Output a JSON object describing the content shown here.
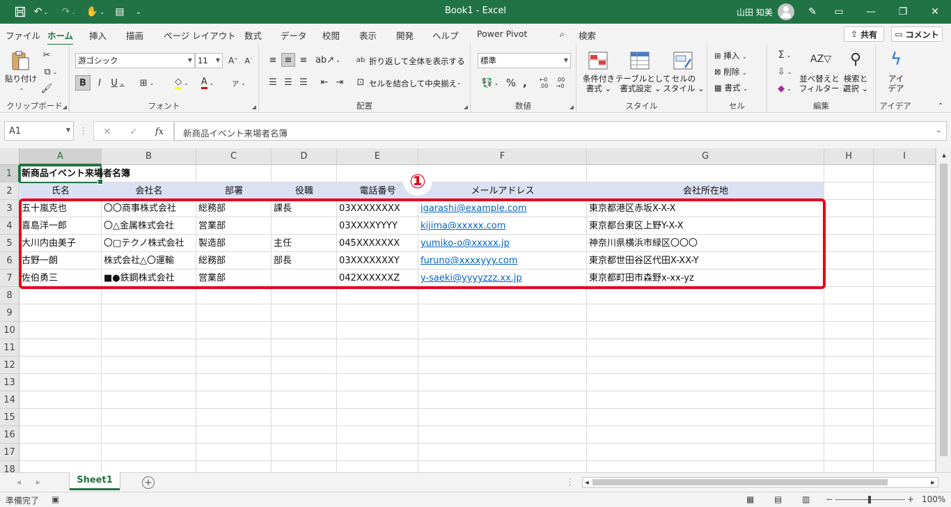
{
  "window": {
    "title": "Book1  -  Excel",
    "user": "山田 知美"
  },
  "menu": {
    "tabs": [
      "ファイル",
      "ホーム",
      "挿入",
      "描画",
      "ページ レイアウト",
      "数式",
      "データ",
      "校閲",
      "表示",
      "開発",
      "ヘルプ",
      "Power Pivot"
    ],
    "search": "検索",
    "share": "共有",
    "comment": "コメント"
  },
  "ribbon": {
    "clipboard": {
      "label": "クリップボード",
      "paste": "貼り付け"
    },
    "font": {
      "label": "フォント",
      "name": "游ゴシック",
      "size": "11"
    },
    "alignment": {
      "label": "配置",
      "wrap": "折り返して全体を表示する",
      "merge": "セルを結合して中央揃え"
    },
    "number": {
      "label": "数値",
      "format": "標準"
    },
    "styles": {
      "label": "スタイル",
      "conditional": [
        "条件付き",
        "書式"
      ],
      "table": [
        "テーブルとして",
        "書式設定"
      ],
      "cell": [
        "セルの",
        "スタイル"
      ]
    },
    "cells": {
      "label": "セル",
      "insert": "挿入",
      "delete": "削除",
      "format": "書式"
    },
    "editing": {
      "label": "編集",
      "sort": [
        "並べ替えと",
        "フィルター"
      ],
      "find": [
        "検索と",
        "選択"
      ]
    },
    "ideas": {
      "label": "アイデア",
      "button": [
        "アイ",
        "デア"
      ]
    }
  },
  "formula_bar": {
    "name_box": "A1",
    "formula": "新商品イベント来場者名簿"
  },
  "sheet": {
    "columns": [
      "A",
      "B",
      "C",
      "D",
      "E",
      "F",
      "G",
      "H",
      "I"
    ],
    "rows": [
      "1",
      "2",
      "3",
      "4",
      "5",
      "6",
      "7",
      "8",
      "9",
      "10",
      "11",
      "12",
      "13",
      "14",
      "15",
      "16",
      "17",
      "18"
    ],
    "title": "新商品イベント来場者名簿",
    "headers": [
      "氏名",
      "会社名",
      "部署",
      "役職",
      "電話番号",
      "メールアドレス",
      "会社所在地"
    ],
    "records": [
      [
        "五十嵐克也",
        "〇〇商事株式会社",
        "総務部",
        "課長",
        "03XXXXXXXX",
        "igarashi@example.com",
        "東京都港区赤坂X-X-X"
      ],
      [
        "喜島洋一郎",
        "〇△金属株式会社",
        "営業部",
        "",
        "03XXXXYYYY",
        "kijima@xxxxx.com",
        "東京都台東区上野Y-X-X"
      ],
      [
        "大川内由美子",
        "〇□テクノ株式会社",
        "製造部",
        "主任",
        "045XXXXXXX",
        "yumiko-o@xxxxx.jp",
        "神奈川県横浜市緑区〇〇〇"
      ],
      [
        "古野一朗",
        "株式会社△〇運輸",
        "総務部",
        "部長",
        "03XXXXXXXY",
        "furuno@xxxxyyy.com",
        "東京都世田谷区代田X-XX-Y"
      ],
      [
        "佐伯勇三",
        "■●鉄鋼株式会社",
        "営業部",
        "",
        "042XXXXXXZ",
        "y-saeki@yyyyzzz.xx.jp",
        "東京都町田市森野x-xx-yz"
      ]
    ],
    "annotation": "①"
  },
  "sheet_tabs": {
    "active": "Sheet1"
  },
  "status": {
    "ready": "準備完了",
    "zoom": "100%"
  }
}
